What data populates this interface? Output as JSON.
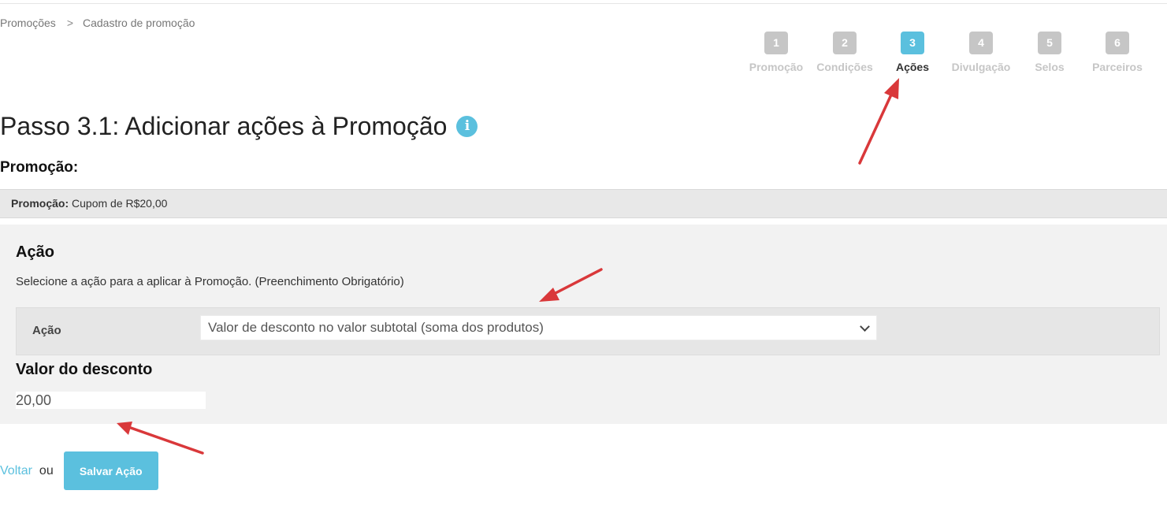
{
  "breadcrumb": {
    "items": [
      "Promoções",
      "Cadastro de promoção"
    ],
    "separator": ">"
  },
  "steps": [
    {
      "number": "1",
      "label": "Promoção",
      "active": false
    },
    {
      "number": "2",
      "label": "Condições",
      "active": false
    },
    {
      "number": "3",
      "label": "Ações",
      "active": true
    },
    {
      "number": "4",
      "label": "Divulgação",
      "active": false
    },
    {
      "number": "5",
      "label": "Selos",
      "active": false
    },
    {
      "number": "6",
      "label": "Parceiros",
      "active": false
    }
  ],
  "page": {
    "title": "Passo 3.1: Adicionar ações à Promoção",
    "info_icon": "info-icon"
  },
  "promotion": {
    "heading": "Promoção:",
    "bar_label": "Promoção:",
    "bar_value": "Cupom de R$20,00"
  },
  "action_section": {
    "title": "Ação",
    "help_text": "Selecione a ação para a aplicar à Promoção. (Preenchimento Obrigatório)",
    "field_label": "Ação",
    "selected_option": "Valor de desconto no valor subtotal (soma dos produtos)"
  },
  "discount": {
    "label": "Valor do desconto",
    "value": "20,00"
  },
  "footer": {
    "back_label": "Voltar",
    "or_text": "ou",
    "save_label": "Salvar Ação"
  },
  "colors": {
    "accent": "#5bc0de",
    "step_inactive": "#c6c6c6",
    "annotation_arrow": "#d9383a"
  }
}
